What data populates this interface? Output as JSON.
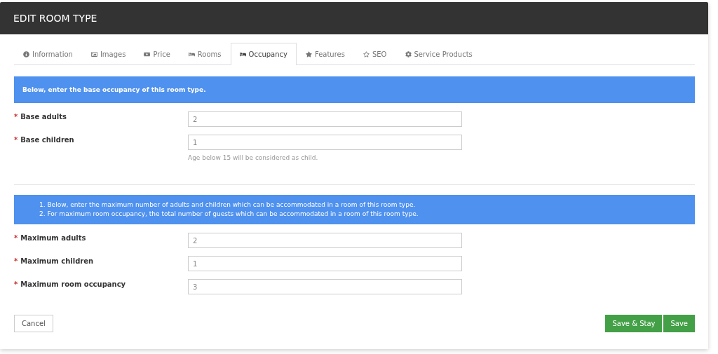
{
  "header": {
    "title": "EDIT ROOM TYPE"
  },
  "tabs": [
    {
      "label": "Information",
      "selected": false
    },
    {
      "label": "Images",
      "selected": false
    },
    {
      "label": "Price",
      "selected": false
    },
    {
      "label": "Rooms",
      "selected": false
    },
    {
      "label": "Occupancy",
      "selected": true
    },
    {
      "label": "Features",
      "selected": false
    },
    {
      "label": "SEO",
      "selected": false
    },
    {
      "label": "Service Products",
      "selected": false
    }
  ],
  "sections": [
    {
      "kind": "plain",
      "info": [
        "Below, enter the base occupancy of this room type."
      ],
      "fields": [
        {
          "mark": "*",
          "label": "Base adults",
          "value": "2"
        },
        {
          "mark": "*",
          "label": "Base children",
          "value": "1",
          "hint": "Age below 15 will be considered as child."
        }
      ]
    },
    {
      "kind": "numbered",
      "info": [
        "1. Below, enter the maximum number of adults and children which can be accommodated in a room of this room type.",
        "2. For maximum room occupancy, the total number of guests which can be accommodated in a room of this room type."
      ],
      "fields": [
        {
          "mark": "*",
          "label": "Maximum adults",
          "value": "2"
        },
        {
          "mark": "*",
          "label": "Maximum children",
          "value": "1"
        },
        {
          "mark": "*",
          "label": "Maximum room occupancy",
          "value": "3"
        }
      ]
    }
  ],
  "footer": {
    "cancel": "Cancel",
    "buttons": [
      "Save & Stay",
      "Save"
    ]
  }
}
